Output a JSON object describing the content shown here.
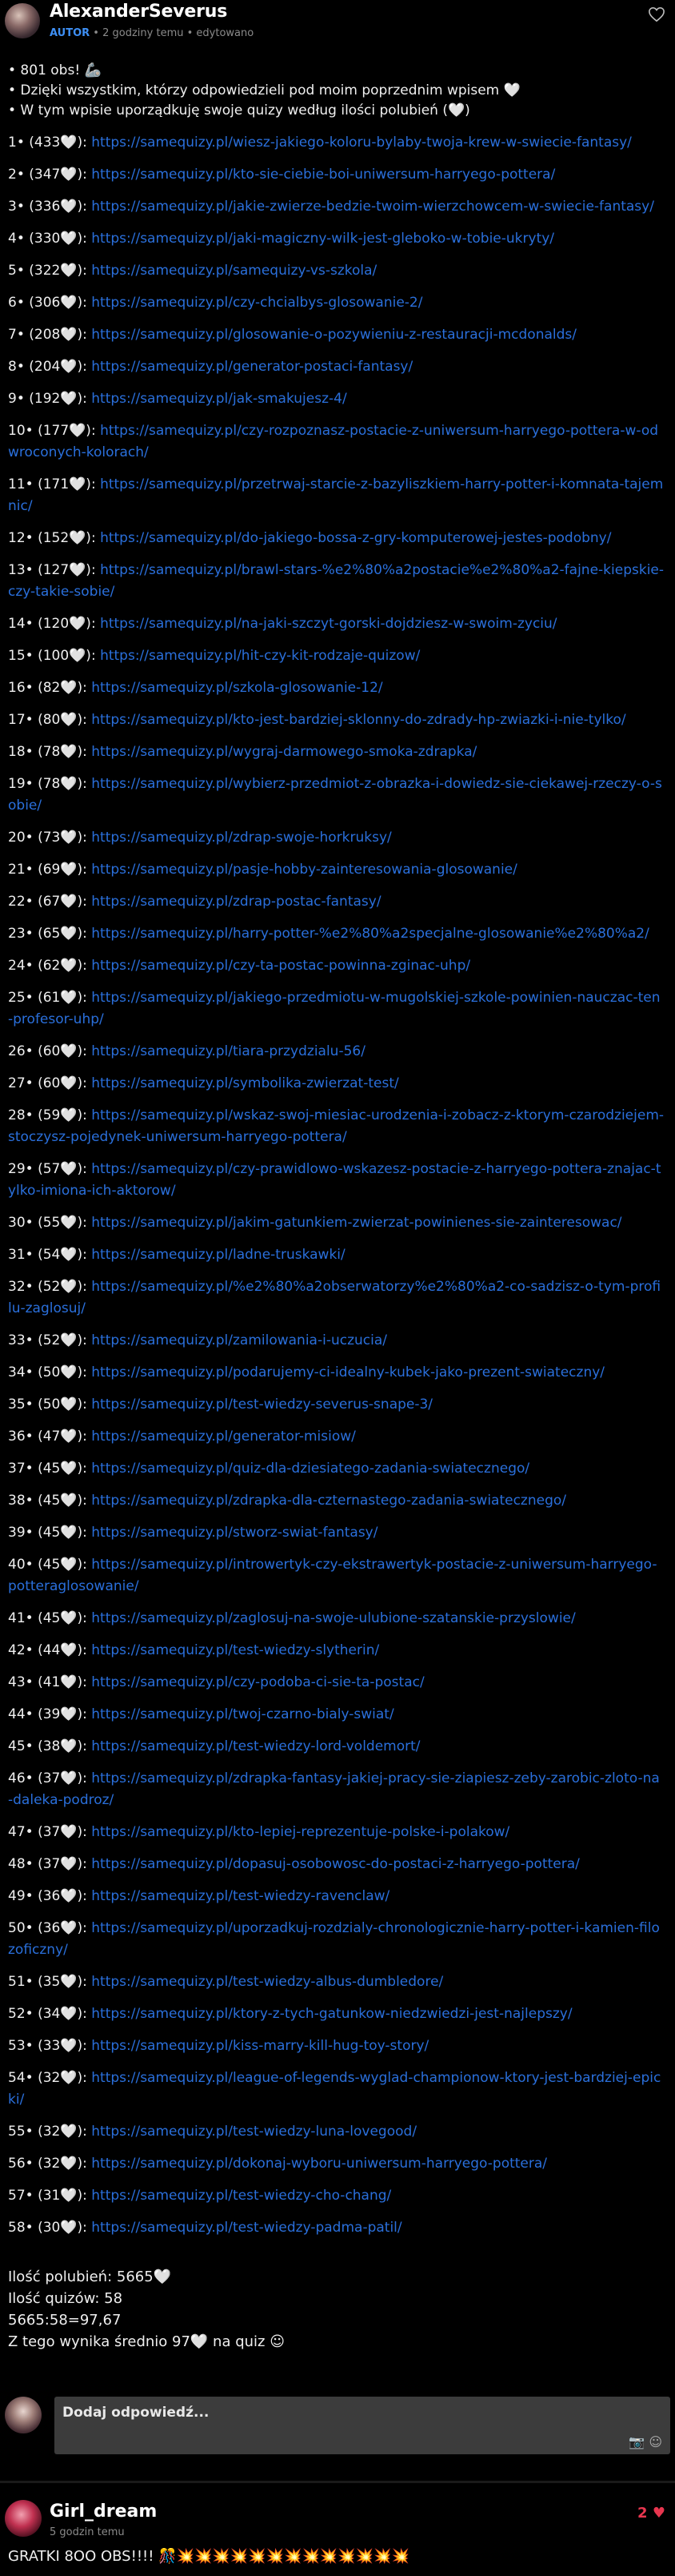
{
  "post": {
    "username": "AlexanderSeverus",
    "role_badge": "AUTOR",
    "time": "2 godziny temu",
    "edited": "edytowano",
    "intro": [
      "• 801 obs! 🦾",
      "• Dzięki wszystkim, którzy odpowiedzieli pod moim poprzednim wpisem 🤍",
      "• W tym wpisie uporządkuję swoje quizy według ilości polubień (🤍)"
    ],
    "quizzes": [
      {
        "n": "1• (433🤍):",
        "url": "https://samequizy.pl/wiesz-jakiego-koloru-bylaby-twoja-krew-w-swiecie-fantasy/"
      },
      {
        "n": "2• (347🤍):",
        "url": "https://samequizy.pl/kto-sie-ciebie-boi-uniwersum-harryego-pottera/"
      },
      {
        "n": "3• (336🤍):",
        "url": "https://samequizy.pl/jakie-zwierze-bedzie-twoim-wierzchowcem-w-swiecie-fantasy/"
      },
      {
        "n": "4• (330🤍):",
        "url": "https://samequizy.pl/jaki-magiczny-wilk-jest-gleboko-w-tobie-ukryty/"
      },
      {
        "n": "5• (322🤍):",
        "url": "https://samequizy.pl/samequizy-vs-szkola/"
      },
      {
        "n": "6• (306🤍):",
        "url": "https://samequizy.pl/czy-chcialbys-glosowanie-2/"
      },
      {
        "n": "7• (208🤍):",
        "url": "https://samequizy.pl/glosowanie-o-pozywieniu-z-restauracji-mcdonalds/"
      },
      {
        "n": "8• (204🤍):",
        "url": "https://samequizy.pl/generator-postaci-fantasy/"
      },
      {
        "n": "9• (192🤍):",
        "url": "https://samequizy.pl/jak-smakujesz-4/"
      },
      {
        "n": "10• (177🤍):",
        "url": "https://samequizy.pl/czy-rozpoznasz-postacie-z-uniwersum-harryego-pottera-w-odwroconych-kolorach/"
      },
      {
        "n": "11• (171🤍):",
        "url": "https://samequizy.pl/przetrwaj-starcie-z-bazyliszkiem-harry-potter-i-komnata-tajemnic/"
      },
      {
        "n": "12• (152🤍):",
        "url": "https://samequizy.pl/do-jakiego-bossa-z-gry-komputerowej-jestes-podobny/"
      },
      {
        "n": "13• (127🤍):",
        "url": "https://samequizy.pl/brawl-stars-%e2%80%a2postacie%e2%80%a2-fajne-kiepskie-czy-takie-sobie/"
      },
      {
        "n": "14• (120🤍):",
        "url": "https://samequizy.pl/na-jaki-szczyt-gorski-dojdziesz-w-swoim-zyciu/"
      },
      {
        "n": "15• (100🤍):",
        "url": "https://samequizy.pl/hit-czy-kit-rodzaje-quizow/"
      },
      {
        "n": "16• (82🤍):",
        "url": "https://samequizy.pl/szkola-glosowanie-12/"
      },
      {
        "n": "17• (80🤍):",
        "url": "https://samequizy.pl/kto-jest-bardziej-sklonny-do-zdrady-hp-zwiazki-i-nie-tylko/"
      },
      {
        "n": "18• (78🤍):",
        "url": "https://samequizy.pl/wygraj-darmowego-smoka-zdrapka/"
      },
      {
        "n": "19• (78🤍):",
        "url": "https://samequizy.pl/wybierz-przedmiot-z-obrazka-i-dowiedz-sie-ciekawej-rzeczy-o-sobie/"
      },
      {
        "n": "20• (73🤍):",
        "url": "https://samequizy.pl/zdrap-swoje-horkruksy/"
      },
      {
        "n": "21• (69🤍):",
        "url": "https://samequizy.pl/pasje-hobby-zainteresowania-glosowanie/"
      },
      {
        "n": "22• (67🤍):",
        "url": "https://samequizy.pl/zdrap-postac-fantasy/"
      },
      {
        "n": "23• (65🤍):",
        "url": "https://samequizy.pl/harry-potter-%e2%80%a2specjalne-glosowanie%e2%80%a2/"
      },
      {
        "n": "24• (62🤍):",
        "url": "https://samequizy.pl/czy-ta-postac-powinna-zginac-uhp/"
      },
      {
        "n": "25• (61🤍):",
        "url": "https://samequizy.pl/jakiego-przedmiotu-w-mugolskiej-szkole-powinien-nauczac-ten-profesor-uhp/"
      },
      {
        "n": "26• (60🤍):",
        "url": "https://samequizy.pl/tiara-przydzialu-56/"
      },
      {
        "n": "27• (60🤍):",
        "url": "https://samequizy.pl/symbolika-zwierzat-test/"
      },
      {
        "n": "28• (59🤍):",
        "url": "https://samequizy.pl/wskaz-swoj-miesiac-urodzenia-i-zobacz-z-ktorym-czarodziejem-stoczysz-pojedynek-uniwersum-harryego-pottera/"
      },
      {
        "n": "29• (57🤍):",
        "url": "https://samequizy.pl/czy-prawidlowo-wskazesz-postacie-z-harryego-pottera-znajac-tylko-imiona-ich-aktorow/"
      },
      {
        "n": "30• (55🤍):",
        "url": "https://samequizy.pl/jakim-gatunkiem-zwierzat-powinienes-sie-zainteresowac/"
      },
      {
        "n": "31• (54🤍):",
        "url": "https://samequizy.pl/ladne-truskawki/"
      },
      {
        "n": "32• (52🤍):",
        "url": "https://samequizy.pl/%e2%80%a2obserwatorzy%e2%80%a2-co-sadzisz-o-tym-profilu-zaglosuj/"
      },
      {
        "n": "33• (52🤍):",
        "url": "https://samequizy.pl/zamilowania-i-uczucia/"
      },
      {
        "n": "34• (50🤍):",
        "url": "https://samequizy.pl/podarujemy-ci-idealny-kubek-jako-prezent-swiateczny/"
      },
      {
        "n": "35• (50🤍):",
        "url": "https://samequizy.pl/test-wiedzy-severus-snape-3/"
      },
      {
        "n": "36• (47🤍):",
        "url": "https://samequizy.pl/generator-misiow/"
      },
      {
        "n": "37• (45🤍):",
        "url": "https://samequizy.pl/quiz-dla-dziesiatego-zadania-swiatecznego/"
      },
      {
        "n": "38• (45🤍):",
        "url": "https://samequizy.pl/zdrapka-dla-czternastego-zadania-swiatecznego/"
      },
      {
        "n": "39• (45🤍):",
        "url": "https://samequizy.pl/stworz-swiat-fantasy/"
      },
      {
        "n": "40• (45🤍):",
        "url": "https://samequizy.pl/introwertyk-czy-ekstrawertyk-postacie-z-uniwersum-harryego-potteraglosowanie/"
      },
      {
        "n": "41• (45🤍):",
        "url": "https://samequizy.pl/zaglosuj-na-swoje-ulubione-szatanskie-przyslowie/"
      },
      {
        "n": "42• (44🤍):",
        "url": "https://samequizy.pl/test-wiedzy-slytherin/"
      },
      {
        "n": "43• (41🤍):",
        "url": "https://samequizy.pl/czy-podoba-ci-sie-ta-postac/"
      },
      {
        "n": "44• (39🤍):",
        "url": "https://samequizy.pl/twoj-czarno-bialy-swiat/"
      },
      {
        "n": "45• (38🤍):",
        "url": "https://samequizy.pl/test-wiedzy-lord-voldemort/"
      },
      {
        "n": "46• (37🤍):",
        "url": "https://samequizy.pl/zdrapka-fantasy-jakiej-pracy-sie-ziapiesz-zeby-zarobic-zloto-na-daleka-podroz/"
      },
      {
        "n": "47• (37🤍):",
        "url": "https://samequizy.pl/kto-lepiej-reprezentuje-polske-i-polakow/"
      },
      {
        "n": "48• (37🤍):",
        "url": "https://samequizy.pl/dopasuj-osobowosc-do-postaci-z-harryego-pottera/"
      },
      {
        "n": "49• (36🤍):",
        "url": "https://samequizy.pl/test-wiedzy-ravenclaw/"
      },
      {
        "n": "50• (36🤍):",
        "url": "https://samequizy.pl/uporzadkuj-rozdzialy-chronologicznie-harry-potter-i-kamien-filozoficzny/"
      },
      {
        "n": "51• (35🤍):",
        "url": "https://samequizy.pl/test-wiedzy-albus-dumbledore/"
      },
      {
        "n": "52• (34🤍):",
        "url": "https://samequizy.pl/ktory-z-tych-gatunkow-niedzwiedzi-jest-najlepszy/"
      },
      {
        "n": "53• (33🤍):",
        "url": "https://samequizy.pl/kiss-marry-kill-hug-toy-story/"
      },
      {
        "n": "54• (32🤍):",
        "url": "https://samequizy.pl/league-of-legends-wyglad-championow-ktory-jest-bardziej-epicki/"
      },
      {
        "n": "55• (32🤍):",
        "url": "https://samequizy.pl/test-wiedzy-luna-lovegood/"
      },
      {
        "n": "56• (32🤍):",
        "url": "https://samequizy.pl/dokonaj-wyboru-uniwersum-harryego-pottera/"
      },
      {
        "n": "57• (31🤍):",
        "url": "https://samequizy.pl/test-wiedzy-cho-chang/"
      },
      {
        "n": "58• (30🤍):",
        "url": "https://samequizy.pl/test-wiedzy-padma-patil/"
      }
    ],
    "summary": [
      "Ilość polubień: 5665🤍",
      "Ilość quizów: 58",
      "5665:58=97,67",
      "Z tego wynika średnio 97🤍 na quiz ☺"
    ]
  },
  "reply": {
    "placeholder": "Dodaj odpowiedź...",
    "icons": [
      "camera-icon",
      "emoji-icon"
    ]
  },
  "comment": {
    "username": "Girl_dream",
    "time": "5 godzin temu",
    "likes": "2",
    "text": "GRATKI 8OO OBS!!!! 🎊💥💥💥💥💥💥💥💥💥💥💥💥💥"
  },
  "colors": {
    "link": "#2a6fdb",
    "author_badge": "#3e8ff4",
    "like_heart": "#e8364f",
    "background": "#000000",
    "reply_box": "#3c3c3c"
  }
}
